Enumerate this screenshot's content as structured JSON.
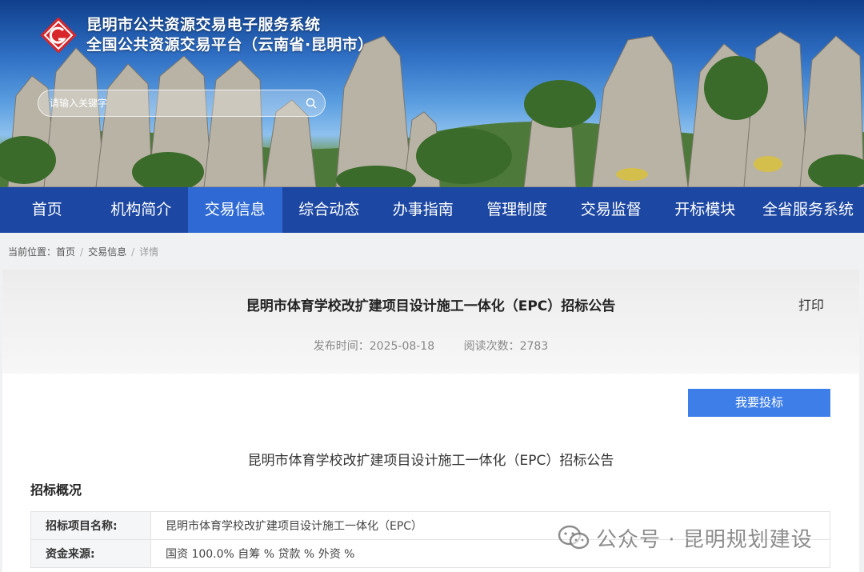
{
  "header": {
    "title_line1": "昆明市公共资源交易电子服务系统",
    "title_line2": "全国公共资源交易平台（云南省·昆明市）",
    "search_placeholder": "请输入关键字"
  },
  "nav": {
    "items": [
      "首页",
      "机构简介",
      "交易信息",
      "综合动态",
      "办事指南",
      "管理制度",
      "交易监督",
      "开标模块",
      "全省服务系统"
    ],
    "active_index": 2
  },
  "breadcrumb": {
    "label": "当前位置：",
    "items": [
      "首页",
      "交易信息",
      "详情"
    ],
    "separator": "/"
  },
  "article": {
    "title": "昆明市体育学校改扩建项目设计施工一体化（EPC）招标公告",
    "print_label": "打印",
    "publish_time": "发布时间：2025-08-18",
    "read_count": "阅读次数：2783",
    "bid_button": "我要投标",
    "notice_title": "昆明市体育学校改扩建项目设计施工一体化（EPC）招标公告",
    "section_heading": "招标概况",
    "rows": [
      {
        "key": "招标项目名称:",
        "value": "昆明市体育学校改扩建项目设计施工一体化（EPC）"
      },
      {
        "key": "资金来源:",
        "value": "国资 100.0% 自筹 % 贷款 % 外资 %"
      }
    ]
  },
  "watermark": {
    "text": "公众号 · 昆明规划建设"
  },
  "colors": {
    "nav_bg": "#1c47a3",
    "nav_active": "#2f6ad4",
    "button_blue": "#3d7ee8",
    "logo_red": "#d8262a"
  }
}
